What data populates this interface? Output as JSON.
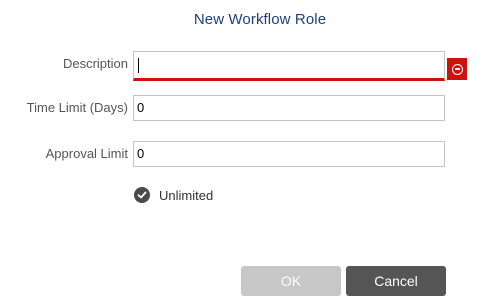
{
  "dialog": {
    "title": "New Workflow Role"
  },
  "form": {
    "description": {
      "label": "Description",
      "value": "",
      "status": "error"
    },
    "time_limit": {
      "label": "Time Limit (Days)",
      "value": "0"
    },
    "approval_limit": {
      "label": "Approval Limit",
      "value": "0"
    },
    "unlimited": {
      "label": "Unlimited",
      "checked": true
    }
  },
  "buttons": {
    "ok_label": "OK",
    "cancel_label": "Cancel"
  },
  "icons": {
    "error": "error-minus-circle-icon",
    "check": "checkmark-icon"
  },
  "colors": {
    "title": "#1f3f7a",
    "error": "#cc1111",
    "ok_disabled": "#c7c7c7",
    "cancel": "#555555"
  }
}
